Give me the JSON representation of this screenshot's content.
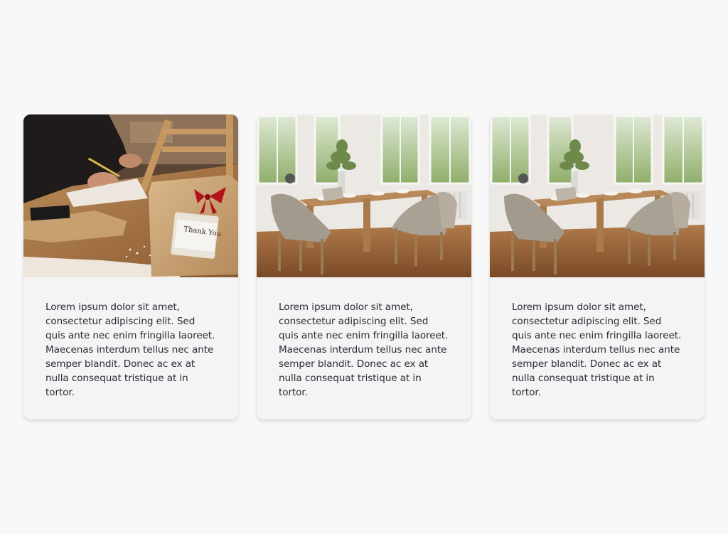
{
  "cards": [
    {
      "image": {
        "icon": "gift-wrapping-photo",
        "tag_text": "Thank You"
      },
      "text": "Lorem ipsum dolor sit amet, consectetur adipiscing elit. Sed quis ante nec enim fringilla laoreet. Maecenas interdum tellus nec ante semper blandit. Donec ac ex at nulla consequat tristique at in tortor."
    },
    {
      "image": {
        "icon": "dining-room-photo"
      },
      "text": "Lorem ipsum dolor sit amet, consectetur adipiscing elit. Sed quis ante nec enim fringilla laoreet. Maecenas interdum tellus nec ante semper blandit. Donec ac ex at nulla consequat tristique at in tortor."
    },
    {
      "image": {
        "icon": "dining-room-photo"
      },
      "text": "Lorem ipsum dolor sit amet, consectetur adipiscing elit. Sed quis ante nec enim fringilla laoreet. Maecenas interdum tellus nec ante semper blandit. Donec ac ex at nulla consequat tristique at in tortor."
    }
  ],
  "colors": {
    "page_background": "#f8f8f8",
    "card_background": "#f4f4f4",
    "text": "#2a2a38"
  }
}
